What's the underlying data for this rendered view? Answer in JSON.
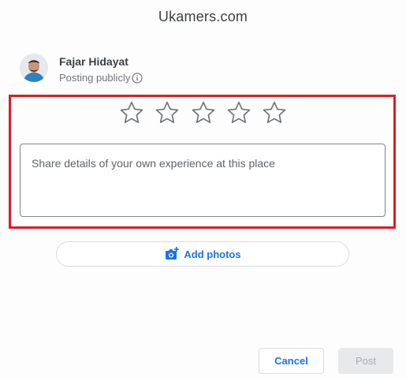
{
  "dialog": {
    "title": "Ukamers.com"
  },
  "user": {
    "name": "Fajar Hidayat",
    "posting_status": "Posting publicly",
    "avatar_icon": "user-avatar",
    "info_icon": "info-icon"
  },
  "rating": {
    "max_stars": 5,
    "selected": 0,
    "star_icon": "star-outline-icon"
  },
  "review": {
    "placeholder": "Share details of your own experience at this place",
    "value": ""
  },
  "photos": {
    "label": "Add photos",
    "icon": "add-photo-icon"
  },
  "actions": {
    "cancel_label": "Cancel",
    "post_label": "Post"
  },
  "colors": {
    "accent": "#1a73e8",
    "highlight_border": "#d81e28",
    "disabled_bg": "#e8e9eb",
    "disabled_text": "#a8abb0"
  }
}
